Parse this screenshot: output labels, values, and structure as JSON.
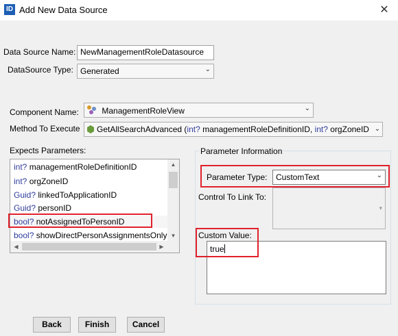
{
  "window": {
    "title": "Add New Data Source",
    "app_icon_text": "ID",
    "close_glyph": "✕"
  },
  "form": {
    "data_source_name_label": "Data Source Name:",
    "data_source_name_value": "NewManagementRoleDatasource",
    "data_source_type_label": "DataSource Type:",
    "data_source_type_value": "Generated",
    "component_name_label": "Component Name:",
    "component_name_value": "ManagementRoleView",
    "method_label": "Method To Execute",
    "method_value": {
      "name": "GetAllSearchAdvanced",
      "p1_type": "int?",
      "p1_name": "managementRoleDefinitionID,",
      "p2_type": "int?",
      "p2_name": "orgZoneID"
    },
    "expects_parameters_label": "Expects Parameters:"
  },
  "parameters": [
    {
      "type": "int?",
      "name": "managementRoleDefinitionID"
    },
    {
      "type": "int?",
      "name": "orgZoneID"
    },
    {
      "type": "Guid?",
      "name": "linkedToApplicationID"
    },
    {
      "type": "Guid?",
      "name": "personID"
    },
    {
      "type": "bool?",
      "name": "notAssignedToPersonID"
    },
    {
      "type": "bool?",
      "name": "showDirectPersonAssignmentsOnly"
    }
  ],
  "parameter_info": {
    "group_title": "Parameter Information",
    "parameter_type_label": "Parameter Type:",
    "parameter_type_value": "CustomText",
    "control_link_label": "Control To Link To:",
    "custom_value_label": "Custom Value:",
    "custom_value": "true"
  },
  "buttons": {
    "back": "Back",
    "finish": "Finish",
    "cancel": "Cancel"
  },
  "colors": {
    "highlight_box": "#e0202a",
    "type_keyword": "#2f3c9c"
  }
}
